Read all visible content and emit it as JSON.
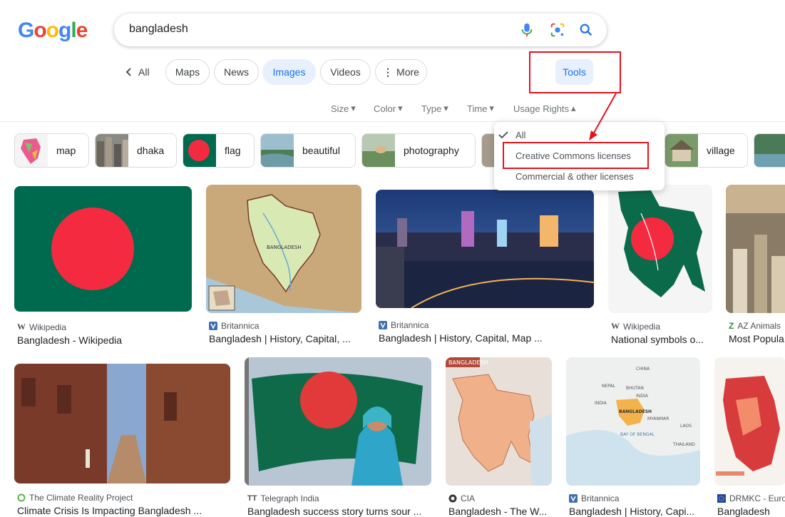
{
  "logo": {
    "letters": [
      "G",
      "o",
      "o",
      "g",
      "l",
      "e"
    ]
  },
  "search": {
    "query": "bangladesh"
  },
  "nav": {
    "back_label": "All",
    "chips": [
      "Maps",
      "News",
      "Images",
      "Videos",
      "More"
    ],
    "tools": "Tools"
  },
  "filters": [
    "Size",
    "Color",
    "Type",
    "Time",
    "Usage Rights"
  ],
  "refinements": [
    "map",
    "dhaka",
    "flag",
    "beautiful",
    "photography",
    "village"
  ],
  "dropdown": {
    "items": [
      "All",
      "Creative Commons licenses",
      "Commercial & other licenses"
    ],
    "selected": "All"
  },
  "results_row1": [
    {
      "source": "Wikipedia",
      "title": "Bangladesh - Wikipedia"
    },
    {
      "source": "Britannica",
      "title": "Bangladesh | History, Capital, ..."
    },
    {
      "source": "Britannica",
      "title": "Bangladesh | History, Capital, Map ..."
    },
    {
      "source": "Wikipedia",
      "title": "National symbols o..."
    },
    {
      "source": "AZ Animals",
      "title": "Most Popula..."
    }
  ],
  "results_row2": [
    {
      "source": "The Climate Reality Project",
      "title": "Climate Crisis Is Impacting Bangladesh ..."
    },
    {
      "source": "Telegraph India",
      "title": "Bangladesh success story turns sour ..."
    },
    {
      "source": "CIA",
      "title": "Bangladesh - The W..."
    },
    {
      "source": "Britannica",
      "title": "Bangladesh | History, Capi..."
    },
    {
      "source": "DRMKC - Europ...",
      "title": "Bangladesh"
    }
  ],
  "image_text": {
    "map_bangladesh": "BANGLADESH",
    "cia_tag": "BANGLADESH",
    "map_labels": [
      "CHINA",
      "NEPAL",
      "BHUTAN",
      "INDIA",
      "BANGLADESH",
      "MYANMAR",
      "BAY OF BENGAL",
      "LAOS",
      "THAILAND",
      "INDIA"
    ]
  },
  "colors": {
    "accent": "#1a73e8",
    "highlight": "#e4121c",
    "flag_green": "#006a4e",
    "flag_red": "#f42a41"
  }
}
